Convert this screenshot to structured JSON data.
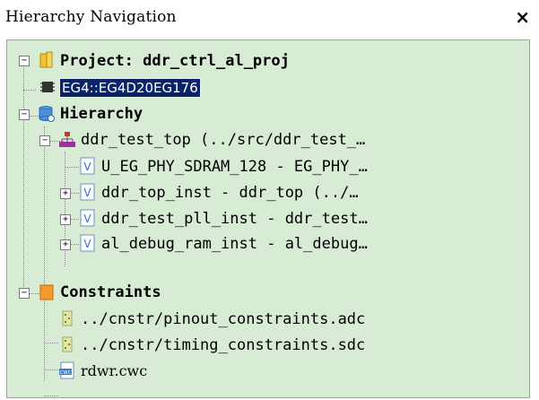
{
  "window": {
    "title": "Hierarchy Navigation",
    "close_glyph": "×"
  },
  "tree": {
    "project": {
      "label": "Project: ddr_ctrl_al_proj",
      "toggle": "−",
      "icon": "folder-icon"
    },
    "device": {
      "label": "EG4::EG4D20EG176",
      "icon": "chip-icon"
    },
    "hierarchy": {
      "label": "Hierarchy",
      "toggle": "−",
      "icon": "database-icon"
    },
    "top": {
      "label": "ddr_test_top (../src/ddr_test_…",
      "toggle": "−",
      "icon": "module-tree-icon"
    },
    "children": [
      {
        "label": "U_EG_PHY_SDRAM_128 - EG_PHY_…",
        "toggle": "",
        "icon": "verilog-file-icon"
      },
      {
        "label": "ddr_top_inst - ddr_top (../…",
        "toggle": "+",
        "icon": "verilog-file-icon"
      },
      {
        "label": "ddr_test_pll_inst - ddr_test…",
        "toggle": "+",
        "icon": "verilog-file-icon"
      },
      {
        "label": "al_debug_ram_inst - al_debug…",
        "toggle": "+",
        "icon": "verilog-file-icon"
      }
    ],
    "constraints": {
      "label": "Constraints",
      "toggle": "−",
      "icon": "constraints-folder-icon"
    },
    "constraint_files": [
      {
        "label": "../cnstr/pinout_constraints.adc",
        "icon": "constraint-file-icon"
      },
      {
        "label": "../cnstr/timing_constraints.sdc",
        "icon": "constraint-file-icon"
      }
    ],
    "other_files": [
      {
        "label": "rdwr.cwc",
        "icon": "cwc-file-icon"
      }
    ]
  },
  "colors": {
    "panel_bg": "#d8ecd5",
    "selection_bg": "#0a246a",
    "selection_fg": "#ffffff"
  }
}
